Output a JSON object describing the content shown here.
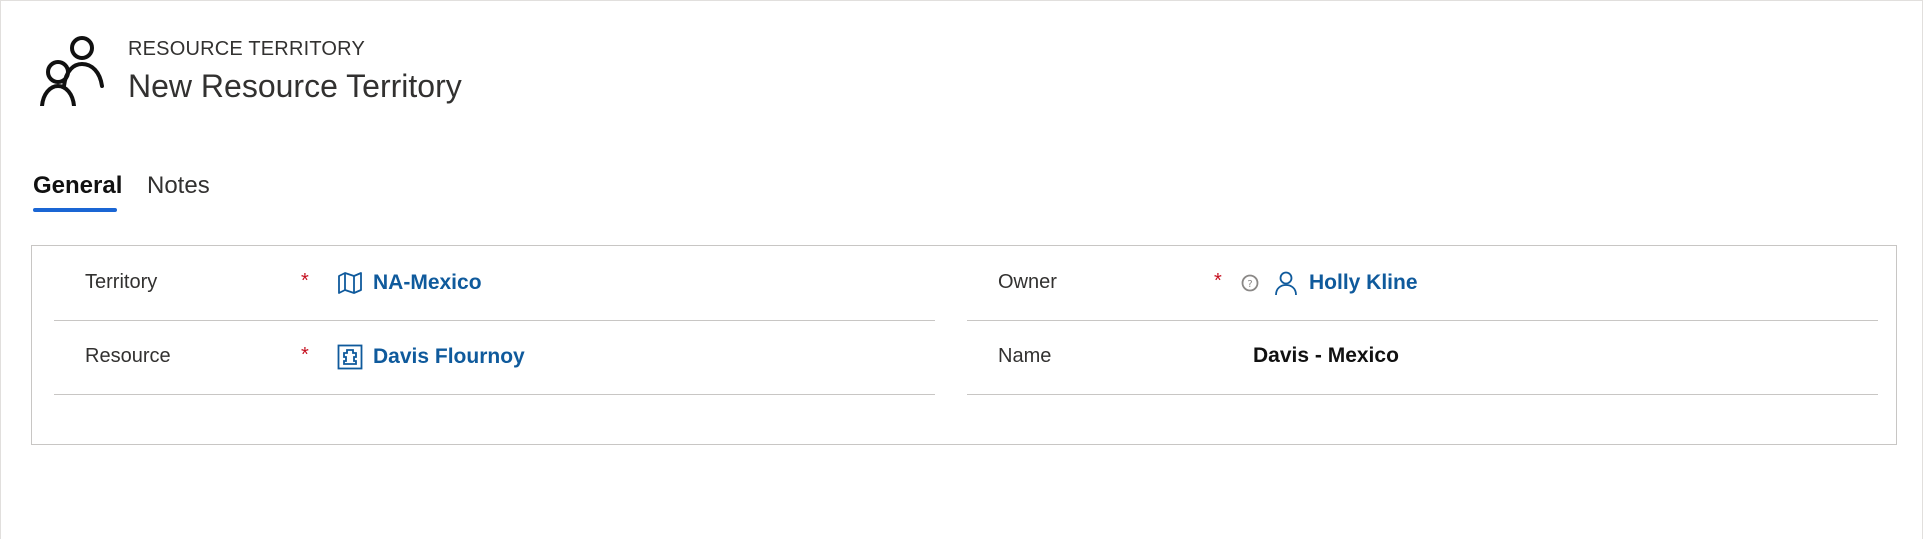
{
  "header": {
    "entity_type": "RESOURCE TERRITORY",
    "title": "New Resource Territory",
    "icon": "people-group-icon"
  },
  "tabs": [
    {
      "label": "General",
      "selected": true
    },
    {
      "label": "Notes",
      "selected": false
    }
  ],
  "form": {
    "territory": {
      "label": "Territory",
      "required": "*",
      "value": "NA-Mexico",
      "icon": "map-icon"
    },
    "resource": {
      "label": "Resource",
      "required": "*",
      "value": "Davis Flournoy",
      "icon": "bookable-resource-icon"
    },
    "owner": {
      "label": "Owner",
      "required": "*",
      "value": "Holly Kline",
      "icon": "person-icon",
      "help_icon": "help-icon"
    },
    "name": {
      "label": "Name",
      "value": "Davis - Mexico"
    }
  },
  "colors": {
    "accent": "#1a66d4",
    "link": "#0f5a9c",
    "required": "#c50f1f",
    "border": "#c8c6c4"
  }
}
